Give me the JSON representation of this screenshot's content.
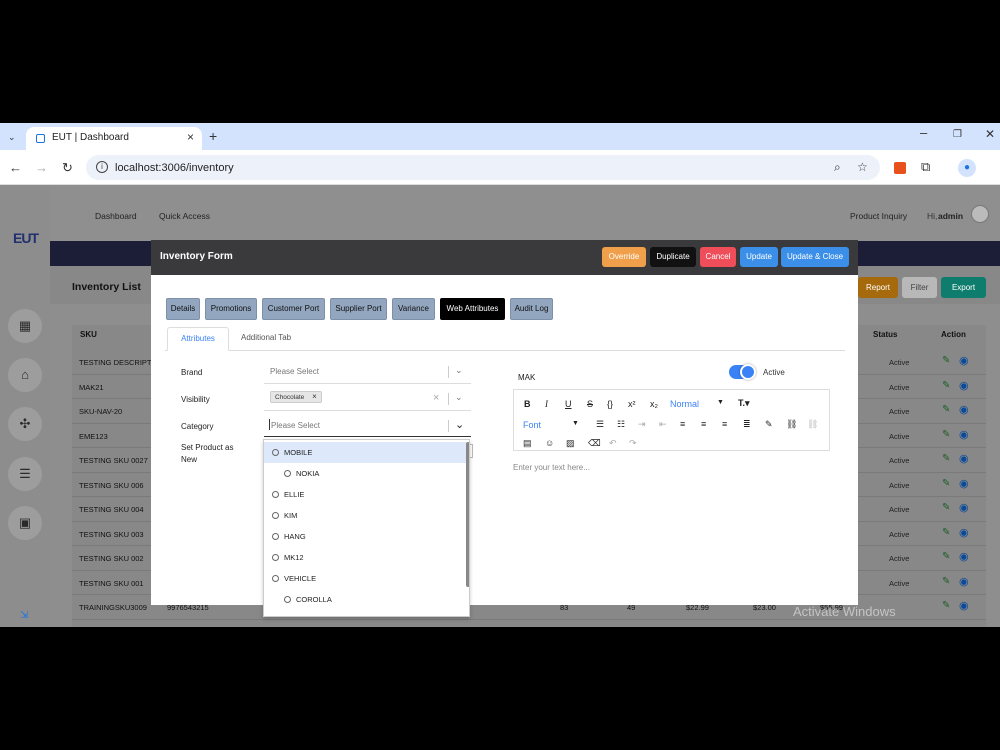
{
  "browser": {
    "tab_title": "EUT | Dashboard",
    "url": "localhost:3006/inventory"
  },
  "app": {
    "logo": "EUT",
    "topnav": {
      "dashboard": "Dashboard",
      "quick_access": "Quick Access",
      "product_inquiry": "Product Inquiry",
      "greeting": "Hi, ",
      "user": "admin"
    },
    "list_title": "Inventory List",
    "header_buttons": {
      "report": "Report",
      "filter": "Filter",
      "export": "Export"
    },
    "table": {
      "columns": {
        "sku": "SKU",
        "status": "Status",
        "action": "Action"
      },
      "rows": [
        {
          "sku": "TESTING DESCRIPTI",
          "status": "Active"
        },
        {
          "sku": "MAK21",
          "status": "Active"
        },
        {
          "sku": "SKU-NAV-20",
          "status": "Active"
        },
        {
          "sku": "EME123",
          "status": "Active"
        },
        {
          "sku": "TESTING SKU 0027",
          "status": "Active"
        },
        {
          "sku": "TESTING SKU 006",
          "status": "Active"
        },
        {
          "sku": "TESTING SKU 004",
          "status": "Active"
        },
        {
          "sku": "TESTING SKU 003",
          "status": "Active"
        },
        {
          "sku": "TESTING SKU 002",
          "status": "Active"
        },
        {
          "sku": "TESTING SKU 001",
          "status": "Active"
        },
        {
          "sku": "TRAININGSKU3009",
          "barcode": "9976543215",
          "q1": "83",
          "q2": "49",
          "p1": "$22.99",
          "p2": "$23.00",
          "p3": "$55.99"
        }
      ]
    }
  },
  "modal": {
    "title": "Inventory Form",
    "buttons": {
      "override": "Override",
      "duplicate": "Duplicate",
      "cancel": "Cancel",
      "update": "Update",
      "update_close": "Update & Close"
    },
    "subtabs": [
      "Details",
      "Promotions",
      "Customer Port",
      "Supplier Port",
      "Variance",
      "Web Attributes",
      "Audit Log"
    ],
    "inner_tabs": {
      "attributes": "Attributes",
      "additional": "Additional Tab"
    },
    "fields": {
      "brand_label": "Brand",
      "brand_placeholder": "Please Select",
      "visibility_label": "Visibility",
      "visibility_chip": "Chocolate",
      "category_label": "Category",
      "category_placeholder": "Please Select",
      "new_label_1": "Set Product as",
      "new_label_2": "New"
    },
    "category_options": [
      "MOBILE",
      "NOKIA",
      "ELLIE",
      "KIM",
      "HANG",
      "MK12",
      "VEHICLE",
      "COROLLA"
    ],
    "editor": {
      "name": "MAK",
      "active_label": "Active",
      "active": true,
      "size_select": "Normal",
      "font_select": "Font",
      "placeholder": "Enter your text here..."
    }
  },
  "watermark": "Activate Windows"
}
